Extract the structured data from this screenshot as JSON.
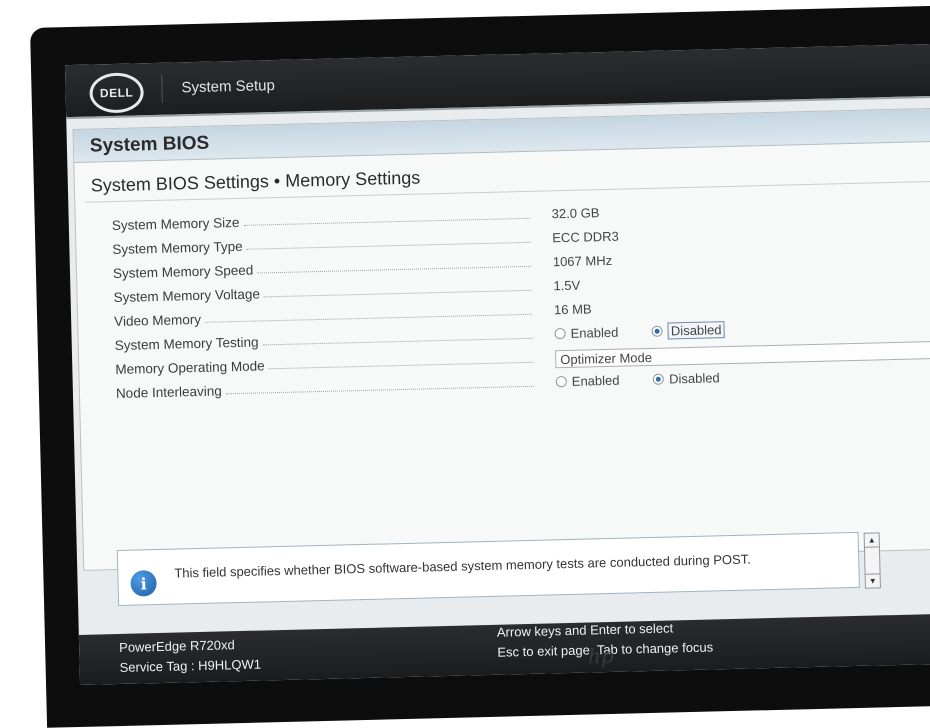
{
  "header": {
    "logo_text": "DELL",
    "app_title": "System Setup"
  },
  "page": {
    "title": "System BIOS",
    "subtitle": "System BIOS Settings • Memory Settings"
  },
  "settings": [
    {
      "label": "System Memory Size",
      "value": "32.0 GB"
    },
    {
      "label": "System Memory Type",
      "value": "ECC DDR3"
    },
    {
      "label": "System Memory Speed",
      "value": "1067 MHz"
    },
    {
      "label": "System Memory Voltage",
      "value": "1.5V"
    },
    {
      "label": "Video Memory",
      "value": "16 MB"
    },
    {
      "label": "System Memory Testing",
      "options": [
        "Enabled",
        "Disabled"
      ],
      "selected": "Disabled"
    },
    {
      "label": "Memory Operating Mode",
      "select_value": "Optimizer Mode"
    },
    {
      "label": "Node Interleaving",
      "options": [
        "Enabled",
        "Disabled"
      ],
      "selected": "Disabled"
    }
  ],
  "help": {
    "text": "This field specifies whether BIOS software-based system memory tests are conducted during POST."
  },
  "footer": {
    "model": "PowerEdge R720xd",
    "service_tag": "Service Tag : H9HLQW1",
    "hint_1": "Arrow keys and Enter to select",
    "hint_2": "Esc to exit page, Tab to change focus"
  },
  "monitor": {
    "brand_text": "hp"
  },
  "colors": {
    "accent": "#2e6fb3",
    "title_bar": "#c5d6e1",
    "header_bg": "#1c1d1f"
  }
}
